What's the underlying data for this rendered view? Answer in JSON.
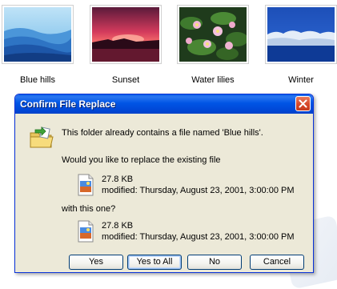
{
  "thumbnails": [
    {
      "caption": "Blue hills"
    },
    {
      "caption": "Sunset"
    },
    {
      "caption": "Water lilies"
    },
    {
      "caption": "Winter"
    }
  ],
  "dialog": {
    "title": "Confirm File Replace",
    "message": "This folder already contains a file named 'Blue hills'.",
    "question": "Would you like to replace the existing file",
    "existing": {
      "size": "27.8 KB",
      "modified": "modified: Thursday, August 23, 2001, 3:00:00 PM"
    },
    "with_label": "with this one?",
    "new": {
      "size": "27.8 KB",
      "modified": "modified: Thursday, August 23, 2001, 3:00:00 PM"
    },
    "buttons": {
      "yes": "Yes",
      "yes_to_all": "Yes to All",
      "no": "No",
      "cancel": "Cancel"
    }
  },
  "colors": {
    "titlebar": "#0055e5",
    "dialog_bg": "#ece9d8",
    "close_button": "#d6482a"
  }
}
